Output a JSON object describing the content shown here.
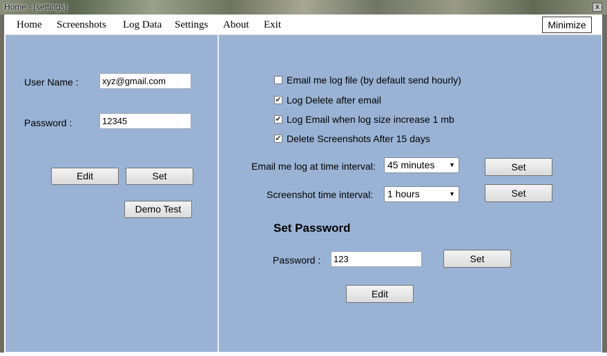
{
  "window": {
    "title": "Home - [settings]",
    "close_glyph": "x"
  },
  "menu": {
    "items": [
      "Home",
      "Screenshots",
      "Log Data",
      "Settings",
      "About",
      "Exit"
    ],
    "minimize_label": "Minimize"
  },
  "left": {
    "username_label": "User Name :",
    "username_value": "xyz@gmail.com",
    "password_label": "Password :",
    "password_value": "12345",
    "edit_label": "Edit",
    "set_label": "Set",
    "demo_label": "Demo Test"
  },
  "right": {
    "options": [
      {
        "label": "Email me log file (by default send hourly)",
        "checked": false
      },
      {
        "label": "Log Delete after email",
        "checked": true
      },
      {
        "label": "Log Email when log size increase 1 mb",
        "checked": true
      },
      {
        "label": "Delete Screenshots After 15 days",
        "checked": true
      }
    ],
    "email_interval_label": "Email me log at time interval:",
    "email_interval_value": "45 minutes",
    "email_interval_set": "Set",
    "screenshot_interval_label": "Screenshot time interval:",
    "screenshot_interval_value": "1 hours",
    "screenshot_interval_set": "Set",
    "set_password_heading": "Set Password",
    "password_label": "Password :",
    "password_value": "123",
    "password_set": "Set",
    "edit_label": "Edit"
  },
  "icons": {
    "checkbox_checked": "check-icon",
    "dropdown": "chevron-down-icon",
    "close": "close-icon"
  }
}
